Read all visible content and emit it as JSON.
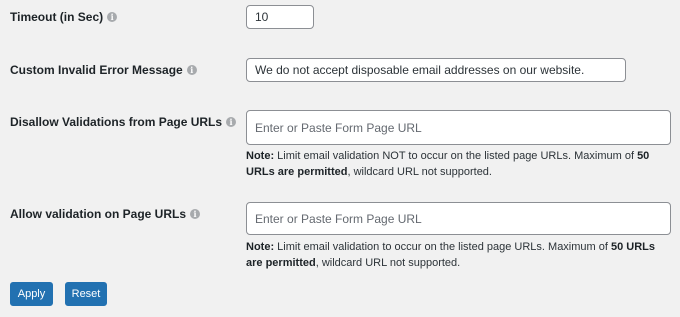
{
  "timeout": {
    "label": "Timeout (in Sec)",
    "value": "10"
  },
  "custom_error": {
    "label": "Custom Invalid Error Message",
    "value": "We do not accept disposable email addresses on our website."
  },
  "disallow": {
    "label": "Disallow Validations from Page URLs",
    "placeholder": "Enter or Paste Form Page URL",
    "note_prefix": "Note:",
    "note_text1": " Limit email validation NOT to occur on the listed page URLs. Maximum of ",
    "note_bold": "50 URLs are permitted",
    "note_text2": ", wildcard URL not supported."
  },
  "allow": {
    "label": "Allow validation on Page URLs",
    "placeholder": "Enter or Paste Form Page URL",
    "note_prefix": "Note:",
    "note_text1": " Limit email validation to occur on the listed page URLs. Maximum of ",
    "note_bold": "50 URLs are permitted",
    "note_text2": ", wildcard URL not supported."
  },
  "buttons": {
    "apply": "Apply",
    "reset": "Reset"
  },
  "info_icon_glyph": "i",
  "colors": {
    "primary_button": "#2271b1",
    "background": "#f1f1f1"
  }
}
